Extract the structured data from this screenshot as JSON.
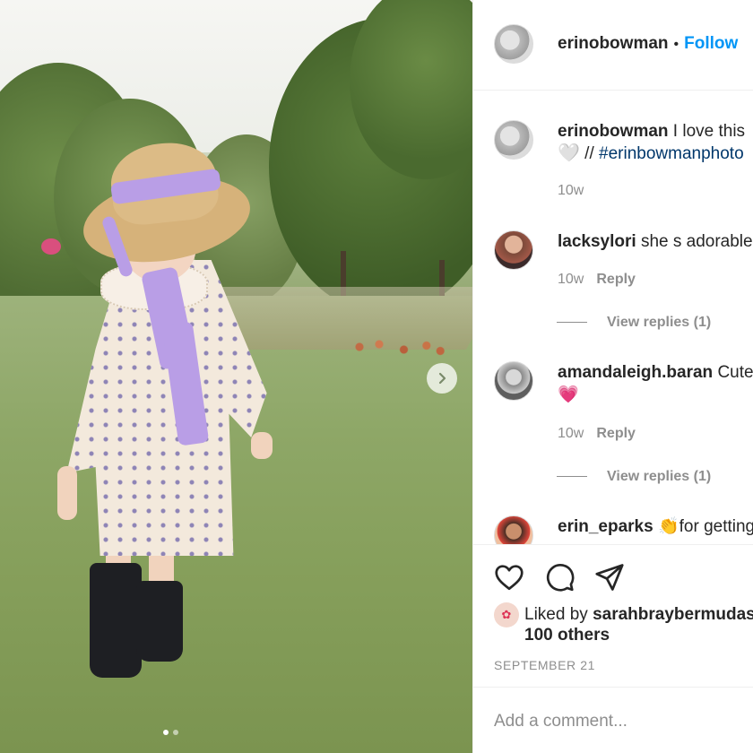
{
  "post": {
    "author": "erinobowman",
    "follow_label": "Follow",
    "separator": "•",
    "next_arrow": "chevron-right-icon",
    "carousel_dots": 2
  },
  "comments": [
    {
      "username": "erinobowman",
      "text": "I love this",
      "line2_emoji": "🤍",
      "line2_sep": " // ",
      "hashtag": "#erinbowmanphoto",
      "time": "10w"
    },
    {
      "username": "lacksylori",
      "text": "she s adorable",
      "time": "10w",
      "reply": "Reply",
      "view_replies": "View replies (1)"
    },
    {
      "username": "amandaleigh.baran",
      "text": "Cute",
      "line2_emoji": "💗",
      "time": "10w",
      "reply": "Reply",
      "view_replies": "View replies (1)"
    },
    {
      "username": "erin_eparks",
      "text": "👏for getting"
    }
  ],
  "actions": {
    "icons": [
      "heart-icon",
      "comment-icon",
      "share-icon"
    ],
    "liked_by_prefix": "Liked by",
    "liked_by_user": "sarahbraybermudas",
    "liked_by_rest": "100 others",
    "date": "SEPTEMBER 21",
    "add_comment_placeholder": "Add a comment..."
  }
}
